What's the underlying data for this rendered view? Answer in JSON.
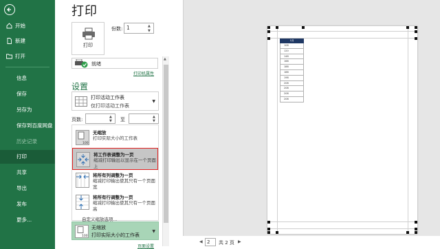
{
  "sidebar": {
    "items": [
      {
        "label": "开始",
        "icon": "home-icon"
      },
      {
        "label": "新建",
        "icon": "new-file-icon"
      },
      {
        "label": "打开",
        "icon": "folder-open-icon"
      },
      {
        "label": "信息"
      },
      {
        "label": "保存"
      },
      {
        "label": "另存为"
      },
      {
        "label": "保存到百度网盘"
      },
      {
        "label": "历史记录"
      },
      {
        "label": "打印"
      },
      {
        "label": "共享"
      },
      {
        "label": "导出"
      },
      {
        "label": "发布"
      },
      {
        "label": "更多..."
      }
    ]
  },
  "main": {
    "title": "打印",
    "print_button": "打印",
    "copies_label": "份数:",
    "copies_value": "1",
    "printer_status": "就绪",
    "printer_properties": "打印机属性",
    "settings_title": "设置",
    "print_what": {
      "line1": "打印活动工作表",
      "line2": "仅打印活动工作表"
    },
    "pages_label": "页数:",
    "pages_to_label": "至",
    "scale_options": [
      {
        "title": "无缩放",
        "desc": "打印实际大小的工作表"
      },
      {
        "title": "将工作表调整为一页",
        "desc": "缩减打印输出以显示在一个页面上"
      },
      {
        "title": "将所有列调整为一页",
        "desc": "缩减打印输出使其只有一个页面宽"
      },
      {
        "title": "将所有行调整为一页",
        "desc": "缩减打印输出使其只有一个页面高"
      }
    ],
    "custom_scale": "自定义缩放选项...",
    "scale_selected": {
      "line1": "无缩放",
      "line2": "打印实际大小的工作表"
    },
    "page_setup": "页面设置"
  },
  "preview": {
    "table_header": "1月",
    "table_values": [
      "108",
      "120",
      "148",
      "168",
      "188",
      "188",
      "198",
      "208",
      "208",
      "208",
      "208"
    ],
    "current_page": "2",
    "total_pages": "共 2 页"
  },
  "colors": {
    "accent": "#217346",
    "highlight_border": "#e02020"
  }
}
